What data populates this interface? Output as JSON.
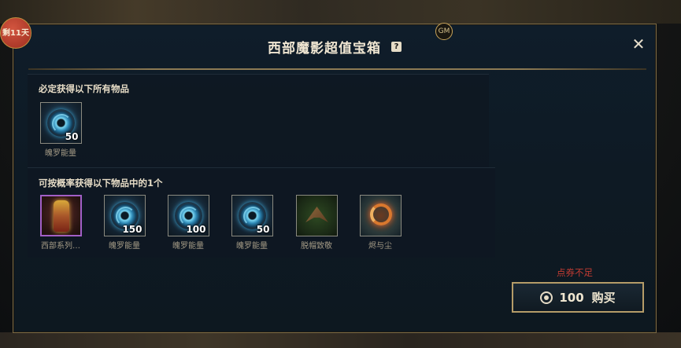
{
  "timer_badge": "剩11天",
  "gm_badge": "GM",
  "dialog": {
    "title": "西部魔影超值宝箱",
    "help_icon": "?",
    "close_icon": "✕"
  },
  "guaranteed": {
    "label": "必定获得以下所有物品",
    "items": [
      {
        "name": "魄罗能量",
        "count": "50",
        "icon": "poro-energy-icon"
      }
    ]
  },
  "chance": {
    "label": "可按概率获得以下物品中的1个",
    "items": [
      {
        "name": "西部系列…",
        "count": "",
        "icon": "lantern-icon",
        "rarity_color": "#a25fc6"
      },
      {
        "name": "魄罗能量",
        "count": "150",
        "icon": "poro-energy-icon"
      },
      {
        "name": "魄罗能量",
        "count": "100",
        "icon": "poro-energy-icon"
      },
      {
        "name": "魄罗能量",
        "count": "50",
        "icon": "poro-energy-icon"
      },
      {
        "name": "脱帽致敬",
        "count": "",
        "icon": "hat-emote-icon"
      },
      {
        "name": "烬与尘",
        "count": "",
        "icon": "ember-icon"
      }
    ]
  },
  "purchase": {
    "warning": "点券不足",
    "warning_color": "#c33c33",
    "price": "100",
    "label": "购买",
    "currency_icon": "coupon-icon"
  }
}
